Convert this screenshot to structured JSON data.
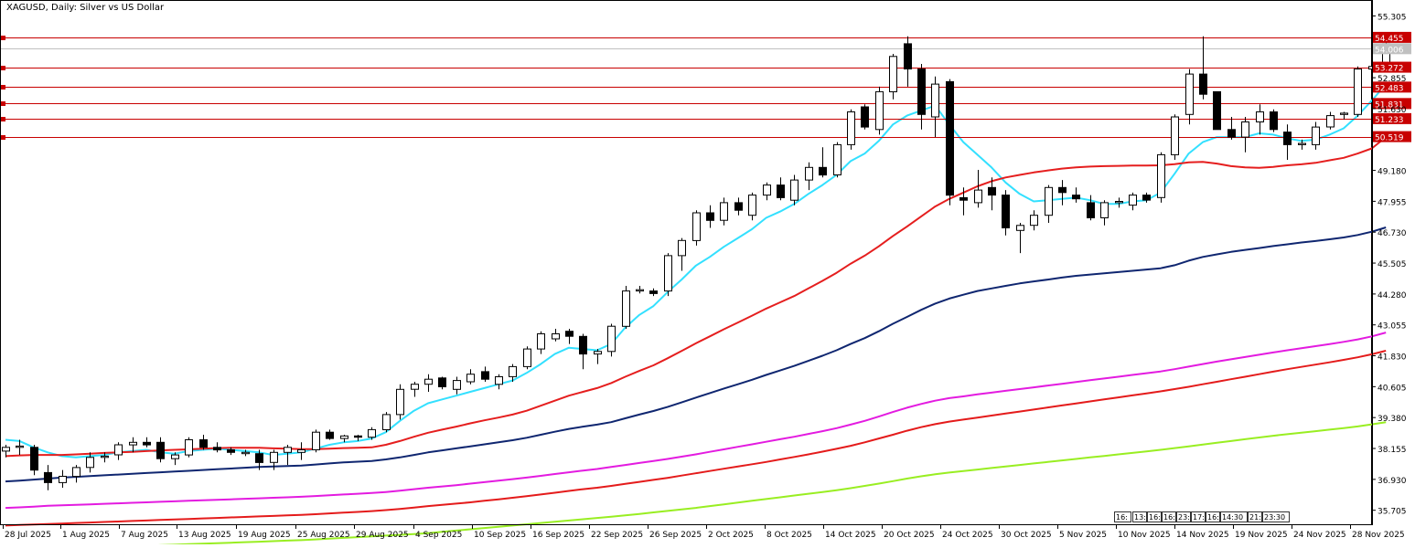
{
  "chart_title": "XAGUSD, Daily:  Silver vs US Dollar",
  "chart_data": {
    "type": "candlestick",
    "symbol": "XAGUSD",
    "timeframe": "Daily",
    "ylim": [
      35.15,
      55.9
    ],
    "y_ticks": [
      "55.305",
      "54.455",
      "54.006",
      "53.272",
      "52.855",
      "52.483",
      "51.831",
      "51.630",
      "51.233",
      "50.519",
      "49.180",
      "47.955",
      "46.730",
      "45.505",
      "44.280",
      "43.055",
      "41.830",
      "40.605",
      "39.380",
      "38.155",
      "36.930",
      "35.705"
    ],
    "x_ticks": [
      "28 Jul 2025",
      "1 Aug 2025",
      "7 Aug 2025",
      "13 Aug 2025",
      "19 Aug 2025",
      "25 Aug 2025",
      "29 Aug 2025",
      "4 Sep 2025",
      "10 Sep 2025",
      "16 Sep 2025",
      "22 Sep 2025",
      "26 Sep 2025",
      "2 Oct 2025",
      "8 Oct 2025",
      "14 Oct 2025",
      "20 Oct 2025",
      "24 Oct 2025",
      "30 Oct 2025",
      "5 Nov 2025",
      "10 Nov 2025",
      "14 Nov 2025",
      "19 Nov 2025",
      "24 Nov 2025",
      "28 Nov 2025"
    ],
    "time_labels": [
      "16:",
      "13:",
      "16:",
      "16:",
      "23:",
      "17:",
      "16:",
      "14:30",
      "21:",
      "23:30"
    ],
    "current_price": 54.006,
    "horizontal_levels": [
      {
        "value": 54.455,
        "label": "54.455"
      },
      {
        "value": 53.272,
        "label": "53.272"
      },
      {
        "value": 52.483,
        "label": "52.483"
      },
      {
        "value": 51.831,
        "label": "51.831"
      },
      {
        "value": 51.233,
        "label": "51.233"
      },
      {
        "value": 50.519,
        "label": "50.519"
      }
    ],
    "candles": [
      [
        38.05,
        38.3,
        37.8,
        38.2
      ],
      [
        38.2,
        38.5,
        37.9,
        38.25
      ],
      [
        38.2,
        38.3,
        37.1,
        37.3
      ],
      [
        37.2,
        37.5,
        36.5,
        36.8
      ],
      [
        36.8,
        37.3,
        36.6,
        37.05
      ],
      [
        37.05,
        37.5,
        36.8,
        37.4
      ],
      [
        37.4,
        38.0,
        37.2,
        37.8
      ],
      [
        37.8,
        38.0,
        37.6,
        37.85
      ],
      [
        37.9,
        38.4,
        37.7,
        38.3
      ],
      [
        38.3,
        38.6,
        38.0,
        38.4
      ],
      [
        38.4,
        38.6,
        38.2,
        38.3
      ],
      [
        38.4,
        38.6,
        37.6,
        37.75
      ],
      [
        37.75,
        38.0,
        37.5,
        37.9
      ],
      [
        37.9,
        38.6,
        37.8,
        38.5
      ],
      [
        38.5,
        38.7,
        38.1,
        38.2
      ],
      [
        38.2,
        38.4,
        38.0,
        38.1
      ],
      [
        38.1,
        38.2,
        37.9,
        38.0
      ],
      [
        37.95,
        38.1,
        37.85,
        38.0
      ],
      [
        37.95,
        38.1,
        37.3,
        37.6
      ],
      [
        37.6,
        38.1,
        37.3,
        38.0
      ],
      [
        38.0,
        38.3,
        37.5,
        38.2
      ],
      [
        38.0,
        38.4,
        37.7,
        38.1
      ],
      [
        38.1,
        38.9,
        38.0,
        38.8
      ],
      [
        38.8,
        38.9,
        38.5,
        38.55
      ],
      [
        38.55,
        38.7,
        38.4,
        38.65
      ],
      [
        38.65,
        38.7,
        38.45,
        38.6
      ],
      [
        38.6,
        39.0,
        38.5,
        38.9
      ],
      [
        38.9,
        39.6,
        38.8,
        39.5
      ],
      [
        39.5,
        40.7,
        39.3,
        40.5
      ],
      [
        40.5,
        40.8,
        40.2,
        40.7
      ],
      [
        40.7,
        41.1,
        40.4,
        40.9
      ],
      [
        40.95,
        41.0,
        40.5,
        40.6
      ],
      [
        40.5,
        41.0,
        40.3,
        40.85
      ],
      [
        40.8,
        41.3,
        40.7,
        41.1
      ],
      [
        41.2,
        41.4,
        40.8,
        40.9
      ],
      [
        40.7,
        41.1,
        40.5,
        41.0
      ],
      [
        41.0,
        41.5,
        40.8,
        41.4
      ],
      [
        41.4,
        42.2,
        41.3,
        42.1
      ],
      [
        42.1,
        42.8,
        41.9,
        42.7
      ],
      [
        42.5,
        42.9,
        42.4,
        42.7
      ],
      [
        42.8,
        42.9,
        42.3,
        42.6
      ],
      [
        42.6,
        42.7,
        41.3,
        41.9
      ],
      [
        41.9,
        42.1,
        41.5,
        42.0
      ],
      [
        42.0,
        43.1,
        41.8,
        43.0
      ],
      [
        43.0,
        44.6,
        42.9,
        44.4
      ],
      [
        44.4,
        44.6,
        44.3,
        44.45
      ],
      [
        44.4,
        44.5,
        44.2,
        44.3
      ],
      [
        44.4,
        45.9,
        44.2,
        45.8
      ],
      [
        45.8,
        46.5,
        45.2,
        46.4
      ],
      [
        46.4,
        47.6,
        46.2,
        47.5
      ],
      [
        47.5,
        47.8,
        46.9,
        47.2
      ],
      [
        47.2,
        48.1,
        47.0,
        47.9
      ],
      [
        47.9,
        48.1,
        47.4,
        47.6
      ],
      [
        47.4,
        48.3,
        47.2,
        48.2
      ],
      [
        48.2,
        48.7,
        48.0,
        48.6
      ],
      [
        48.6,
        48.9,
        48.0,
        48.1
      ],
      [
        48.0,
        49.0,
        47.8,
        48.8
      ],
      [
        48.8,
        49.5,
        48.4,
        49.3
      ],
      [
        49.3,
        50.1,
        48.9,
        49.0
      ],
      [
        49.0,
        50.3,
        48.9,
        50.2
      ],
      [
        50.2,
        51.6,
        50.0,
        51.5
      ],
      [
        51.7,
        51.8,
        50.8,
        50.9
      ],
      [
        50.8,
        52.5,
        50.6,
        52.3
      ],
      [
        52.3,
        53.8,
        52.0,
        53.7
      ],
      [
        54.2,
        54.5,
        52.5,
        53.2
      ],
      [
        53.2,
        53.4,
        50.8,
        51.4
      ],
      [
        51.3,
        52.9,
        50.5,
        52.6
      ],
      [
        52.7,
        52.8,
        47.8,
        48.2
      ],
      [
        48.1,
        48.5,
        47.4,
        48.0
      ],
      [
        47.9,
        49.2,
        47.7,
        48.4
      ],
      [
        48.5,
        48.9,
        47.6,
        48.2
      ],
      [
        48.2,
        48.4,
        46.6,
        46.9
      ],
      [
        46.8,
        47.1,
        45.9,
        47.0
      ],
      [
        47.0,
        47.6,
        46.8,
        47.4
      ],
      [
        47.4,
        48.6,
        47.1,
        48.5
      ],
      [
        48.5,
        48.8,
        47.8,
        48.3
      ],
      [
        48.2,
        48.5,
        47.9,
        48.05
      ],
      [
        47.9,
        48.2,
        47.2,
        47.3
      ],
      [
        47.3,
        48.0,
        47.0,
        47.9
      ],
      [
        47.9,
        48.1,
        47.7,
        47.95
      ],
      [
        47.8,
        48.3,
        47.6,
        48.2
      ],
      [
        48.2,
        48.3,
        47.9,
        48.0
      ],
      [
        48.1,
        49.9,
        47.9,
        49.8
      ],
      [
        49.8,
        51.4,
        49.6,
        51.3
      ],
      [
        51.4,
        53.2,
        51.0,
        53.0
      ],
      [
        53.0,
        54.5,
        52.0,
        52.2
      ],
      [
        52.3,
        52.3,
        50.8,
        50.8
      ],
      [
        50.8,
        51.3,
        50.4,
        50.5
      ],
      [
        50.5,
        51.3,
        49.9,
        51.1
      ],
      [
        51.1,
        51.8,
        50.6,
        51.5
      ],
      [
        51.5,
        51.6,
        50.7,
        50.8
      ],
      [
        50.7,
        51.0,
        49.6,
        50.2
      ],
      [
        50.2,
        50.4,
        50.0,
        50.25
      ],
      [
        50.2,
        51.1,
        50.0,
        50.9
      ],
      [
        50.9,
        51.5,
        50.8,
        51.35
      ],
      [
        51.4,
        51.5,
        51.2,
        51.45
      ],
      [
        51.4,
        53.3,
        51.3,
        53.2
      ],
      [
        53.2,
        53.8,
        52.8,
        53.3
      ],
      [
        53.3,
        54.4,
        53.1,
        54.2
      ]
    ],
    "series": [
      {
        "color": "#33e0ff",
        "values": [
          38.5,
          38.45,
          38.2,
          38.0,
          37.85,
          37.8,
          37.85,
          37.9,
          38.0,
          38.05,
          38.1,
          38.0,
          37.95,
          38.05,
          38.1,
          38.15,
          38.1,
          38.05,
          38.0,
          37.9,
          37.95,
          38.0,
          38.15,
          38.3,
          38.4,
          38.45,
          38.55,
          38.8,
          39.25,
          39.65,
          39.95,
          40.1,
          40.25,
          40.4,
          40.55,
          40.7,
          40.85,
          41.15,
          41.5,
          41.9,
          42.15,
          42.1,
          42.05,
          42.3,
          42.95,
          43.45,
          43.8,
          44.35,
          44.85,
          45.4,
          45.75,
          46.15,
          46.5,
          46.85,
          47.3,
          47.55,
          47.85,
          48.25,
          48.6,
          49.0,
          49.55,
          49.85,
          50.35,
          51.0,
          51.35,
          51.55,
          51.75,
          51.0,
          50.3,
          49.8,
          49.3,
          48.7,
          48.25,
          47.95,
          48.0,
          48.05,
          48.1,
          48.0,
          47.85,
          47.85,
          47.95,
          48.0,
          48.3,
          49.05,
          49.85,
          50.3,
          50.5,
          50.5,
          50.5,
          50.65,
          50.6,
          50.45,
          50.35,
          50.4,
          50.6,
          50.85,
          51.35,
          51.95,
          52.6
        ]
      },
      {
        "color": "#e51e1e",
        "values": [
          37.85,
          37.88,
          37.9,
          37.9,
          37.9,
          37.92,
          37.95,
          37.98,
          38.0,
          38.02,
          38.05,
          38.08,
          38.1,
          38.12,
          38.15,
          38.17,
          38.18,
          38.18,
          38.18,
          38.16,
          38.15,
          38.13,
          38.13,
          38.15,
          38.17,
          38.18,
          38.2,
          38.3,
          38.45,
          38.62,
          38.78,
          38.9,
          39.02,
          39.15,
          39.27,
          39.38,
          39.5,
          39.65,
          39.85,
          40.05,
          40.25,
          40.4,
          40.55,
          40.75,
          41.0,
          41.23,
          41.45,
          41.73,
          42.02,
          42.32,
          42.6,
          42.88,
          43.15,
          43.42,
          43.7,
          43.95,
          44.2,
          44.5,
          44.8,
          45.12,
          45.48,
          45.8,
          46.17,
          46.58,
          46.95,
          47.35,
          47.75,
          48.05,
          48.3,
          48.55,
          48.75,
          48.9,
          49.0,
          49.1,
          49.18,
          49.25,
          49.3,
          49.33,
          49.35,
          49.36,
          49.37,
          49.37,
          49.38,
          49.43,
          49.5,
          49.52,
          49.45,
          49.35,
          49.3,
          49.28,
          49.32,
          49.38,
          49.42,
          49.48,
          49.58,
          49.68,
          49.85,
          50.05,
          50.5
        ]
      },
      {
        "color": "#0f2670",
        "values": [
          36.85,
          36.88,
          36.92,
          36.96,
          37.0,
          37.03,
          37.06,
          37.09,
          37.12,
          37.15,
          37.18,
          37.21,
          37.24,
          37.27,
          37.3,
          37.33,
          37.36,
          37.39,
          37.42,
          37.44,
          37.46,
          37.48,
          37.52,
          37.56,
          37.6,
          37.63,
          37.66,
          37.72,
          37.8,
          37.9,
          38.0,
          38.08,
          38.16,
          38.24,
          38.32,
          38.4,
          38.48,
          38.58,
          38.7,
          38.82,
          38.93,
          39.02,
          39.1,
          39.2,
          39.35,
          39.5,
          39.64,
          39.8,
          39.98,
          40.17,
          40.35,
          40.53,
          40.7,
          40.88,
          41.07,
          41.25,
          41.43,
          41.63,
          41.83,
          42.05,
          42.3,
          42.53,
          42.8,
          43.1,
          43.37,
          43.65,
          43.9,
          44.1,
          44.25,
          44.4,
          44.5,
          44.6,
          44.7,
          44.78,
          44.85,
          44.93,
          45.0,
          45.05,
          45.1,
          45.15,
          45.2,
          45.25,
          45.3,
          45.42,
          45.6,
          45.75,
          45.85,
          45.95,
          46.03,
          46.1,
          46.18,
          46.25,
          46.32,
          46.38,
          46.45,
          46.52,
          46.62,
          46.75,
          46.92
        ]
      },
      {
        "color": "#e31be0",
        "values": [
          35.8,
          35.82,
          35.85,
          35.88,
          35.9,
          35.92,
          35.94,
          35.96,
          35.98,
          36.0,
          36.02,
          36.04,
          36.06,
          36.08,
          36.1,
          36.12,
          36.14,
          36.16,
          36.18,
          36.2,
          36.22,
          36.24,
          36.27,
          36.3,
          36.33,
          36.36,
          36.39,
          36.43,
          36.48,
          36.54,
          36.6,
          36.65,
          36.7,
          36.76,
          36.82,
          36.88,
          36.94,
          37.0,
          37.07,
          37.14,
          37.21,
          37.28,
          37.34,
          37.42,
          37.5,
          37.58,
          37.66,
          37.74,
          37.83,
          37.92,
          38.02,
          38.12,
          38.22,
          38.32,
          38.42,
          38.52,
          38.62,
          38.73,
          38.84,
          38.96,
          39.1,
          39.25,
          39.42,
          39.6,
          39.77,
          39.92,
          40.05,
          40.15,
          40.22,
          40.3,
          40.37,
          40.44,
          40.51,
          40.58,
          40.65,
          40.72,
          40.79,
          40.86,
          40.93,
          41.0,
          41.07,
          41.14,
          41.21,
          41.3,
          41.4,
          41.5,
          41.6,
          41.69,
          41.78,
          41.87,
          41.96,
          42.05,
          42.13,
          42.21,
          42.29,
          42.38,
          42.48,
          42.6,
          42.75
        ]
      },
      {
        "color": "#e41b1b",
        "values": [
          35.1,
          35.12,
          35.14,
          35.16,
          35.18,
          35.2,
          35.22,
          35.24,
          35.26,
          35.28,
          35.3,
          35.32,
          35.34,
          35.36,
          35.38,
          35.4,
          35.42,
          35.44,
          35.46,
          35.48,
          35.5,
          35.52,
          35.55,
          35.58,
          35.61,
          35.64,
          35.67,
          35.71,
          35.76,
          35.81,
          35.87,
          35.92,
          35.97,
          36.02,
          36.08,
          36.14,
          36.2,
          36.26,
          36.33,
          36.4,
          36.47,
          36.54,
          36.6,
          36.67,
          36.75,
          36.83,
          36.91,
          36.99,
          37.08,
          37.17,
          37.26,
          37.35,
          37.44,
          37.53,
          37.62,
          37.72,
          37.82,
          37.92,
          38.03,
          38.14,
          38.26,
          38.4,
          38.55,
          38.7,
          38.86,
          39.0,
          39.12,
          39.22,
          39.3,
          39.38,
          39.46,
          39.54,
          39.62,
          39.7,
          39.78,
          39.86,
          39.94,
          40.02,
          40.1,
          40.18,
          40.26,
          40.34,
          40.42,
          40.51,
          40.6,
          40.7,
          40.8,
          40.9,
          41.0,
          41.1,
          41.2,
          41.3,
          41.39,
          41.48,
          41.57,
          41.67,
          41.77,
          41.89,
          42.03
        ]
      },
      {
        "color": "#99ee22",
        "values": [
          34.1,
          34.12,
          34.14,
          34.16,
          34.18,
          34.2,
          34.22,
          34.24,
          34.26,
          34.28,
          34.3,
          34.32,
          34.34,
          34.36,
          34.38,
          34.4,
          34.42,
          34.44,
          34.46,
          34.48,
          34.5,
          34.52,
          34.55,
          34.58,
          34.61,
          34.64,
          34.67,
          34.7,
          34.73,
          34.76,
          34.8,
          34.85,
          34.9,
          34.95,
          35.0,
          35.05,
          35.1,
          35.15,
          35.2,
          35.25,
          35.3,
          35.35,
          35.4,
          35.45,
          35.5,
          35.56,
          35.62,
          35.68,
          35.74,
          35.8,
          35.87,
          35.94,
          36.01,
          36.08,
          36.15,
          36.22,
          36.29,
          36.36,
          36.43,
          36.5,
          36.58,
          36.67,
          36.76,
          36.86,
          36.96,
          37.05,
          37.13,
          37.2,
          37.26,
          37.32,
          37.38,
          37.44,
          37.5,
          37.56,
          37.62,
          37.68,
          37.74,
          37.8,
          37.86,
          37.92,
          37.98,
          38.04,
          38.1,
          38.17,
          38.24,
          38.31,
          38.38,
          38.45,
          38.52,
          38.59,
          38.66,
          38.72,
          38.78,
          38.84,
          38.9,
          38.96,
          39.03,
          39.11,
          39.2
        ]
      }
    ]
  }
}
